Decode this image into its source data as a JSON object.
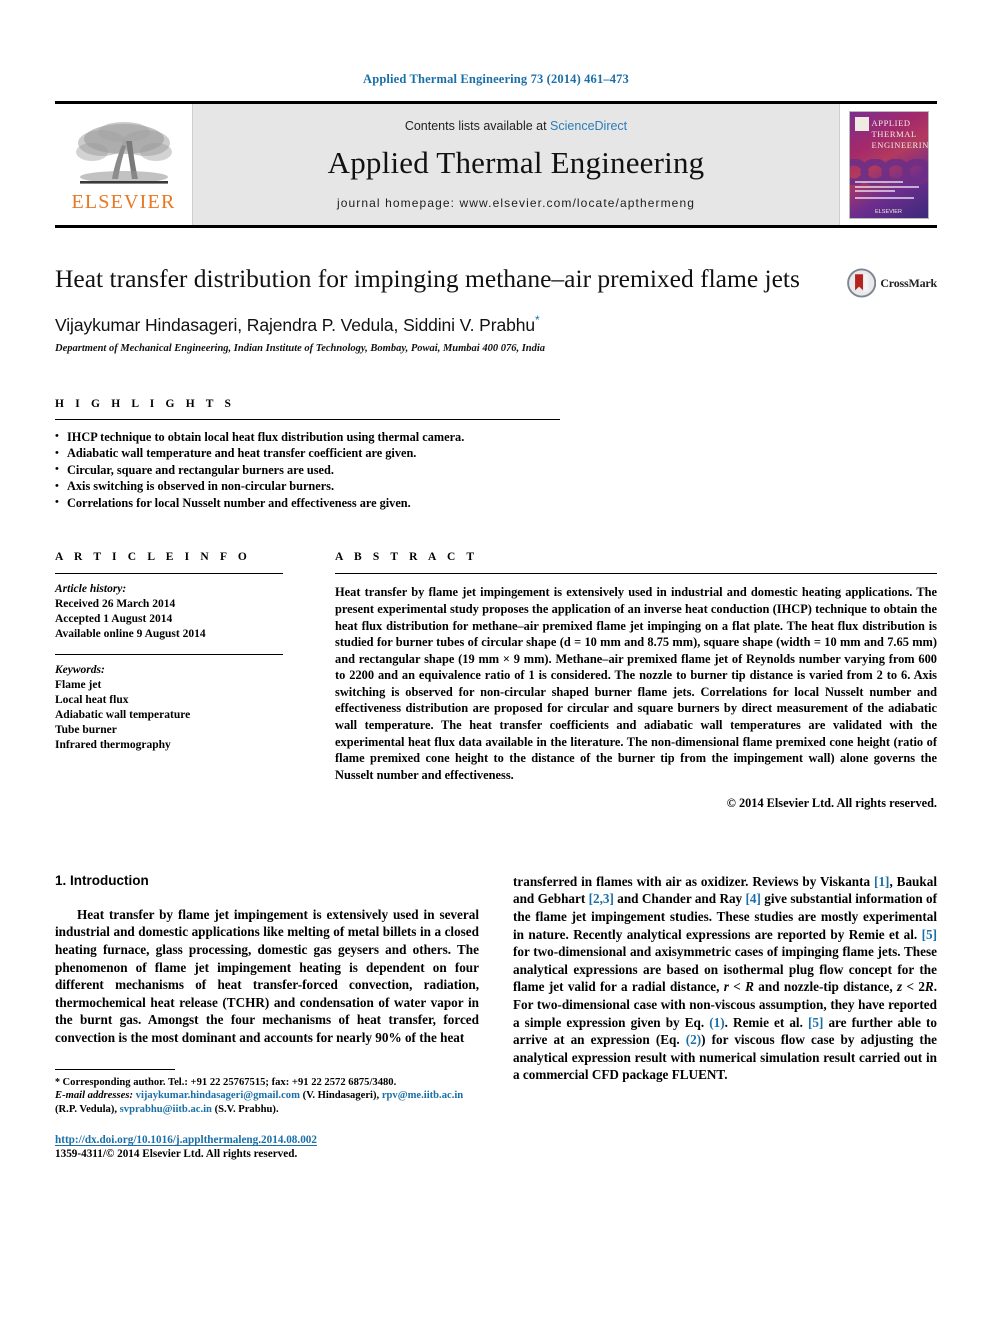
{
  "running_head": "Applied Thermal Engineering 73 (2014) 461–473",
  "masthead": {
    "publisher": "ELSEVIER",
    "contents_prefix": "Contents lists available at ",
    "contents_link": "ScienceDirect",
    "journal_title": "Applied Thermal Engineering",
    "homepage": "journal homepage: www.elsevier.com/locate/apthermeng",
    "cover_title_lines": [
      "APPLIED",
      "THERMAL",
      "ENGINEERING"
    ],
    "cover_publisher": "ELSEVIER"
  },
  "article": {
    "title": "Heat transfer distribution for impinging methane–air premixed flame jets",
    "crossmark_label": "CrossMark",
    "authors": "Vijaykumar Hindasageri, Rajendra P. Vedula, Siddini V. Prabhu",
    "author_marker": "*",
    "affiliation": "Department of Mechanical Engineering, Indian Institute of Technology, Bombay, Powai, Mumbai 400 076, India"
  },
  "highlights": {
    "heading": "H I G H L I G H T S",
    "items": [
      "IHCP technique to obtain local heat flux distribution using thermal camera.",
      "Adiabatic wall temperature and heat transfer coefficient are given.",
      "Circular, square and rectangular burners are used.",
      "Axis switching is observed in non-circular burners.",
      "Correlations for local Nusselt number and effectiveness are given."
    ]
  },
  "article_info": {
    "heading": "A R T I C L E   I N F O",
    "history_label": "Article history:",
    "history": [
      "Received 26 March 2014",
      "Accepted 1 August 2014",
      "Available online 9 August 2014"
    ],
    "keywords_label": "Keywords:",
    "keywords": [
      "Flame jet",
      "Local heat flux",
      "Adiabatic wall temperature",
      "Tube burner",
      "Infrared thermography"
    ]
  },
  "abstract": {
    "heading": "A B S T R A C T",
    "text": "Heat transfer by flame jet impingement is extensively used in industrial and domestic heating applications. The present experimental study proposes the application of an inverse heat conduction (IHCP) technique to obtain the heat flux distribution for methane–air premixed flame jet impinging on a flat plate. The heat flux distribution is studied for burner tubes of circular shape (d = 10 mm and 8.75 mm), square shape (width = 10 mm and 7.65 mm) and rectangular shape (19 mm × 9 mm). Methane–air premixed flame jet of Reynolds number varying from 600 to 2200 and an equivalence ratio of 1 is considered. The nozzle to burner tip distance is varied from 2 to 6. Axis switching is observed for non-circular shaped burner flame jets. Correlations for local Nusselt number and effectiveness distribution are proposed for circular and square burners by direct measurement of the adiabatic wall temperature. The heat transfer coefficients and adiabatic wall temperatures are validated with the experimental heat flux data available in the literature. The non-dimensional flame premixed cone height (ratio of flame premixed cone height to the distance of the burner tip from the impingement wall) alone governs the Nusselt number and effectiveness.",
    "copyright": "© 2014 Elsevier Ltd. All rights reserved."
  },
  "body": {
    "section_heading": "1.  Introduction",
    "left_paragraph": "Heat transfer by flame jet impingement is extensively used in several industrial and domestic applications like melting of metal billets in a closed heating furnace, glass processing, domestic gas geysers and others. The phenomenon of flame jet impingement heating is dependent on four different mechanisms of heat transfer-forced convection, radiation, thermochemical heat release (TCHR) and condensation of water vapor in the burnt gas. Amongst the four mechanisms of heat transfer, forced convection is the most dominant and accounts for nearly 90% of the heat",
    "right_paragraph_parts": [
      {
        "t": "transferred in flames with air as oxidizer. Reviews by Viskanta ",
        "k": "plain"
      },
      {
        "t": "[1]",
        "k": "ref"
      },
      {
        "t": ", Baukal and Gebhart ",
        "k": "plain"
      },
      {
        "t": "[2,3]",
        "k": "ref"
      },
      {
        "t": " and Chander and Ray ",
        "k": "plain"
      },
      {
        "t": "[4]",
        "k": "ref"
      },
      {
        "t": " give substantial information of the flame jet impingement studies. These studies are mostly experimental in nature. Recently analytical expressions are reported by Remie et al. ",
        "k": "plain"
      },
      {
        "t": "[5]",
        "k": "ref"
      },
      {
        "t": " for two-dimensional and axisymmetric cases of impinging flame jets. These analytical expressions are based on isothermal plug flow concept for the flame jet valid for a radial distance, ",
        "k": "plain"
      },
      {
        "t": "r",
        "k": "ital"
      },
      {
        "t": " < ",
        "k": "plain"
      },
      {
        "t": "R",
        "k": "ital"
      },
      {
        "t": " and nozzle-tip distance, ",
        "k": "plain"
      },
      {
        "t": "z",
        "k": "ital"
      },
      {
        "t": " < 2",
        "k": "plain"
      },
      {
        "t": "R",
        "k": "ital"
      },
      {
        "t": ". For two-dimensional case with non-viscous assumption, they have reported a simple expression given by Eq. ",
        "k": "plain"
      },
      {
        "t": "(1)",
        "k": "ref"
      },
      {
        "t": ". Remie et al. ",
        "k": "plain"
      },
      {
        "t": "[5]",
        "k": "ref"
      },
      {
        "t": " are further able to arrive at an expression (Eq. ",
        "k": "plain"
      },
      {
        "t": "(2)",
        "k": "ref"
      },
      {
        "t": ") for viscous flow case by adjusting the analytical expression result with numerical simulation result carried out in a commercial CFD package FLUENT.",
        "k": "plain"
      }
    ]
  },
  "footnote": {
    "corresponding": "Corresponding author. Tel.: +91 22 25767515; fax: +91 22 2572 6875/3480.",
    "email_label": "E-mail addresses:",
    "emails": [
      {
        "address": "vijaykumar.hindasageri@gmail.com",
        "person": "(V. Hindasageri)"
      },
      {
        "address": "rpv@me.iitb.ac.in",
        "person": "(R.P. Vedula)"
      },
      {
        "address": "svprabhu@iitb.ac.in",
        "person": "(S.V. Prabhu)"
      }
    ],
    "doi": "http://dx.doi.org/10.1016/j.applthermaleng.2014.08.002",
    "issn_line": "1359-4311/© 2014 Elsevier Ltd. All rights reserved."
  },
  "colors": {
    "link_blue": "#1a6fa8",
    "elsevier_orange": "#E87722",
    "masthead_grey": "#e6e6e6",
    "crossmark_red": "#b5231f"
  }
}
